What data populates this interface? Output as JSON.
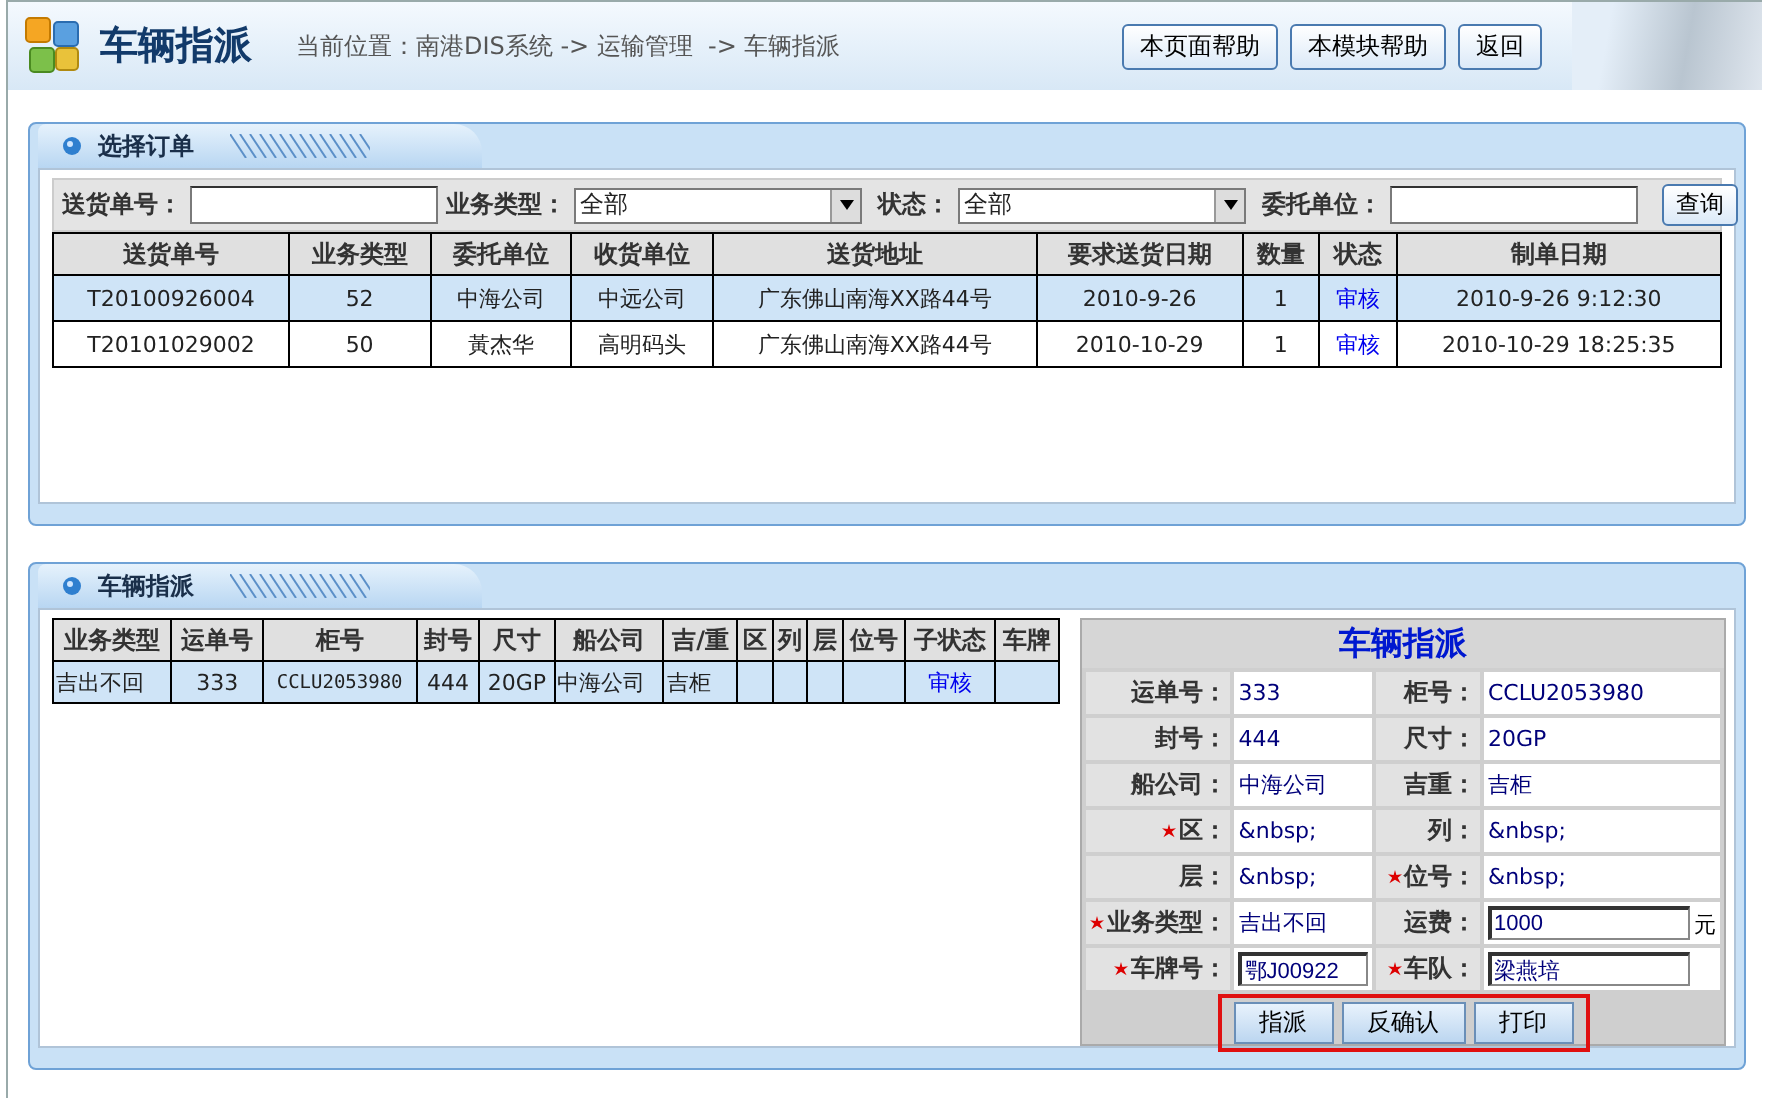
{
  "header": {
    "title": "车辆指派",
    "breadcrumb": "当前位置：南港DIS系统 -> 运输管理  -> 车辆指派",
    "buttons": [
      "本页面帮助",
      "本模块帮助",
      "返回"
    ]
  },
  "order_panel": {
    "title": "选择订单",
    "filters": [
      {
        "kind": "input",
        "label": "送货单号："
      },
      {
        "kind": "select",
        "label": "业务类型：",
        "value": "全部"
      },
      {
        "kind": "select",
        "label": "状态：",
        "value": "全部"
      },
      {
        "kind": "input",
        "label": "委托单位："
      }
    ],
    "search_button": "查询",
    "table": {
      "columns": [
        "送货单号",
        "业务类型",
        "委托单位",
        "收货单位",
        "送货地址",
        "要求送货日期",
        "数量",
        "状态",
        "制单日期"
      ],
      "rows": [
        {
          "selected": true,
          "cells": [
            "T20100926004",
            "52",
            "中海公司",
            "中远公司",
            "广东佛山南海XX路44号",
            "2010-9-26",
            "1",
            "审核",
            "2010-9-26 9:12:30"
          ]
        },
        {
          "selected": false,
          "cells": [
            "T20101029002",
            "50",
            "黃杰华",
            "高明码头",
            "广东佛山南海XX路44号",
            "2010-10-29",
            "1",
            "审核",
            "2010-10-29 18:25:35"
          ]
        }
      ]
    }
  },
  "dispatch_panel": {
    "title": "车辆指派",
    "table": {
      "columns": [
        "业务类型",
        "运单号",
        "柜号",
        "封号",
        "尺寸",
        "船公司",
        "吉/重",
        "区",
        "列",
        "层",
        "位号",
        "子状态",
        "车牌"
      ],
      "rows": [
        {
          "selected": true,
          "cells": [
            "吉出不回",
            "333",
            "CCLU2053980",
            "444",
            "20GP",
            "中海公司",
            "吉柜",
            "",
            "",
            "",
            "",
            "审核",
            ""
          ]
        }
      ]
    },
    "form": {
      "title": "车辆指派",
      "rows": [
        [
          {
            "label": "运单号：",
            "required": false,
            "kind": "text",
            "value": "333"
          },
          {
            "label": "柜号：",
            "required": false,
            "kind": "text",
            "value": "CCLU2053980"
          }
        ],
        [
          {
            "label": "封号：",
            "required": false,
            "kind": "text",
            "value": "444"
          },
          {
            "label": "尺寸：",
            "required": false,
            "kind": "text",
            "value": "20GP"
          }
        ],
        [
          {
            "label": "船公司：",
            "required": false,
            "kind": "text",
            "value": "中海公司"
          },
          {
            "label": "吉重：",
            "required": false,
            "kind": "text",
            "value": "吉柜"
          }
        ],
        [
          {
            "label": "区：",
            "required": true,
            "kind": "text",
            "value": "&nbsp;"
          },
          {
            "label": "列：",
            "required": false,
            "kind": "text",
            "value": "&nbsp;"
          }
        ],
        [
          {
            "label": "层：",
            "required": false,
            "kind": "text",
            "value": "&nbsp;"
          },
          {
            "label": "位号：",
            "required": true,
            "kind": "text",
            "value": "&nbsp;"
          }
        ],
        [
          {
            "label": "业务类型：",
            "required": true,
            "kind": "text",
            "value": "吉出不回"
          },
          {
            "label": "运费：",
            "required": false,
            "kind": "input",
            "value": "1000",
            "unit": "元"
          }
        ],
        [
          {
            "label": "车牌号：",
            "required": true,
            "kind": "input",
            "value": "鄂J00922"
          },
          {
            "label": "车队：",
            "required": true,
            "kind": "input",
            "value": "梁燕培"
          }
        ]
      ],
      "buttons": [
        "指派",
        "反确认",
        "打印"
      ],
      "buttons_highlighted": true
    }
  }
}
